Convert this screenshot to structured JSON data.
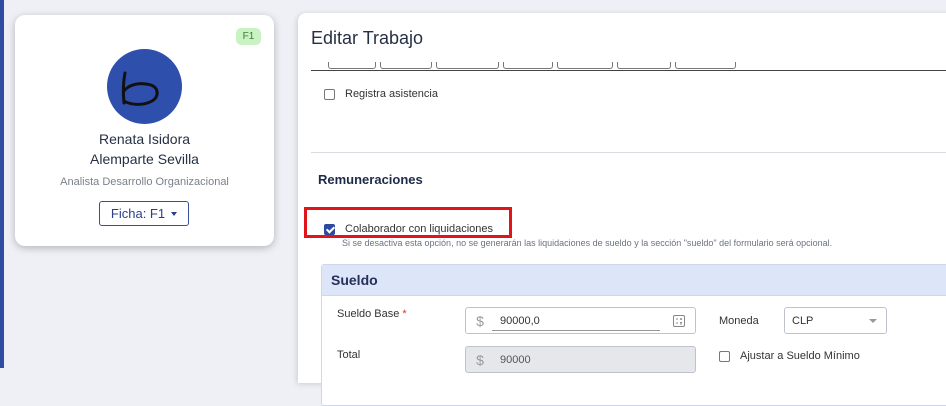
{
  "profile": {
    "badge": "F1",
    "name_line1": "Renata Isidora",
    "name_line2": "Alemparte Sevilla",
    "role": "Analista Desarrollo Organizacional",
    "ficha_button": "Ficha: F1",
    "avatar_color": "#2f4fad"
  },
  "main": {
    "title": "Editar Trabajo",
    "registra_asistencia": {
      "label": "Registra asistencia",
      "checked": false
    },
    "remuneraciones": {
      "title": "Remuneraciones",
      "colaborador": {
        "label": "Colaborador con liquidaciones",
        "checked": true
      },
      "help_text": "Si se desactiva esta opción, no se generarán las liquidaciones de sueldo y la sección \"sueldo\" del formulario será opcional."
    },
    "sueldo": {
      "title": "Sueldo",
      "sueldo_base": {
        "label": "Sueldo Base",
        "required_mark": "*",
        "currency_symbol": "$",
        "value": "90000,0"
      },
      "moneda": {
        "label": "Moneda",
        "value": "CLP"
      },
      "total": {
        "label": "Total",
        "currency_symbol": "$",
        "value": "90000"
      },
      "ajustar": {
        "label": "Ajustar a Sueldo Mínimo",
        "checked": false
      }
    }
  },
  "colors": {
    "accent": "#2e4aa0",
    "highlight": "#e0151a",
    "badge_bg": "#c9f3c2"
  }
}
